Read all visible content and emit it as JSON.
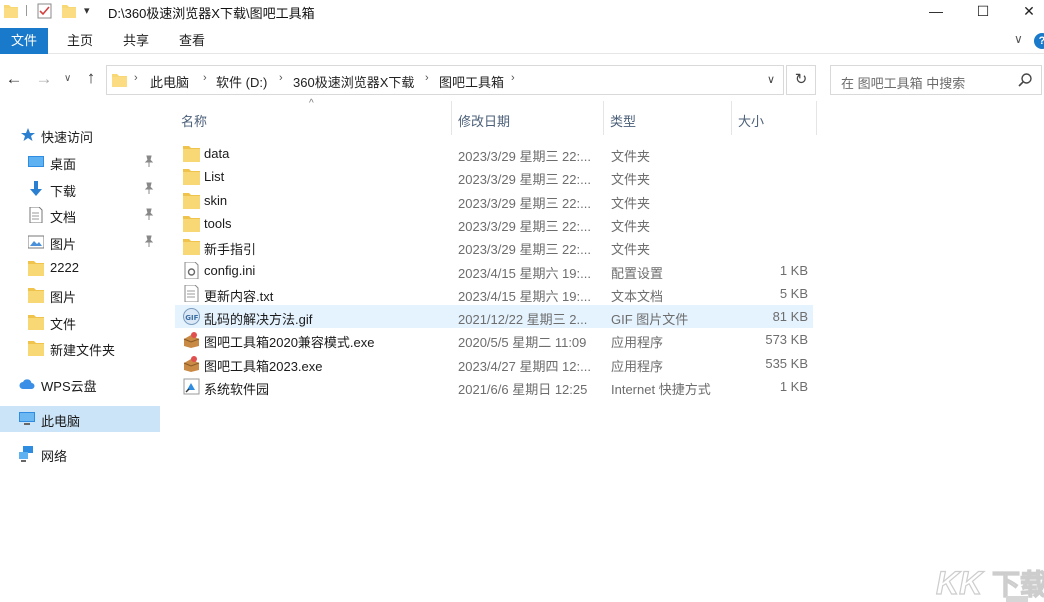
{
  "window": {
    "title": "D:\\360极速浏览器X下载\\图吧工具箱",
    "min_label": "—",
    "max_label": "☐",
    "close_label": "✕"
  },
  "ribbon": {
    "tabs": [
      "文件",
      "主页",
      "共享",
      "查看"
    ],
    "collapse_glyph": "∨",
    "help_glyph": "?"
  },
  "nav": {
    "back": "←",
    "forward": "→",
    "recent": "∨",
    "up": "↑",
    "refresh": "↻",
    "dropdown": "∨",
    "breadcrumb_sep": "›",
    "breadcrumb": [
      "此电脑",
      "软件 (D:)",
      "360极速浏览器X下载",
      "图吧工具箱"
    ]
  },
  "search": {
    "placeholder": "在 图吧工具箱 中搜索"
  },
  "sidebar": {
    "items": [
      {
        "label": "快速访问",
        "icon": "star-icon"
      },
      {
        "label": "桌面",
        "icon": "desktop-icon",
        "pinned": true
      },
      {
        "label": "下载",
        "icon": "download-icon",
        "pinned": true
      },
      {
        "label": "文档",
        "icon": "document-icon",
        "pinned": true
      },
      {
        "label": "图片",
        "icon": "picture-icon",
        "pinned": true
      },
      {
        "label": "2222",
        "icon": "folder-icon"
      },
      {
        "label": "图片",
        "icon": "folder-icon"
      },
      {
        "label": "文件",
        "icon": "folder-icon"
      },
      {
        "label": "新建文件夹",
        "icon": "folder-icon"
      },
      {
        "label": "WPS云盘",
        "icon": "cloud-icon"
      },
      {
        "label": "此电脑",
        "icon": "computer-icon",
        "selected": true
      },
      {
        "label": "网络",
        "icon": "network-icon"
      }
    ]
  },
  "columns": {
    "name": "名称",
    "date": "修改日期",
    "type": "类型",
    "size": "大小"
  },
  "files": [
    {
      "name": "data",
      "date": "2023/3/29 星期三 22:...",
      "type": "文件夹",
      "size": "",
      "icon": "folder-icon"
    },
    {
      "name": "List",
      "date": "2023/3/29 星期三 22:...",
      "type": "文件夹",
      "size": "",
      "icon": "folder-icon"
    },
    {
      "name": "skin",
      "date": "2023/3/29 星期三 22:...",
      "type": "文件夹",
      "size": "",
      "icon": "folder-icon"
    },
    {
      "name": "tools",
      "date": "2023/3/29 星期三 22:...",
      "type": "文件夹",
      "size": "",
      "icon": "folder-icon"
    },
    {
      "name": "新手指引",
      "date": "2023/3/29 星期三 22:...",
      "type": "文件夹",
      "size": "",
      "icon": "folder-icon"
    },
    {
      "name": "config.ini",
      "date": "2023/4/15 星期六 19:...",
      "type": "配置设置",
      "size": "1 KB",
      "icon": "settings-file-icon"
    },
    {
      "name": "更新内容.txt",
      "date": "2023/4/15 星期六 19:...",
      "type": "文本文档",
      "size": "5 KB",
      "icon": "text-file-icon"
    },
    {
      "name": "乱码的解决方法.gif",
      "date": "2021/12/22 星期三 2...",
      "type": "GIF 图片文件",
      "size": "81 KB",
      "icon": "gif-file-icon",
      "hover": true
    },
    {
      "name": "图吧工具箱2020兼容模式.exe",
      "date": "2020/5/5 星期二 11:09",
      "type": "应用程序",
      "size": "573 KB",
      "icon": "app-icon"
    },
    {
      "name": "图吧工具箱2023.exe",
      "date": "2023/4/27 星期四 12:...",
      "type": "应用程序",
      "size": "535 KB",
      "icon": "app-icon"
    },
    {
      "name": "系统软件园",
      "date": "2021/6/6 星期日 12:25",
      "type": "Internet 快捷方式",
      "size": "1 KB",
      "icon": "internet-shortcut-icon"
    }
  ],
  "watermark": {
    "text": "KK下载"
  },
  "colors": {
    "accent": "#1979ca",
    "selected": "#cce4f7",
    "hover": "#e5f3ff",
    "folder": "#f8d775"
  }
}
